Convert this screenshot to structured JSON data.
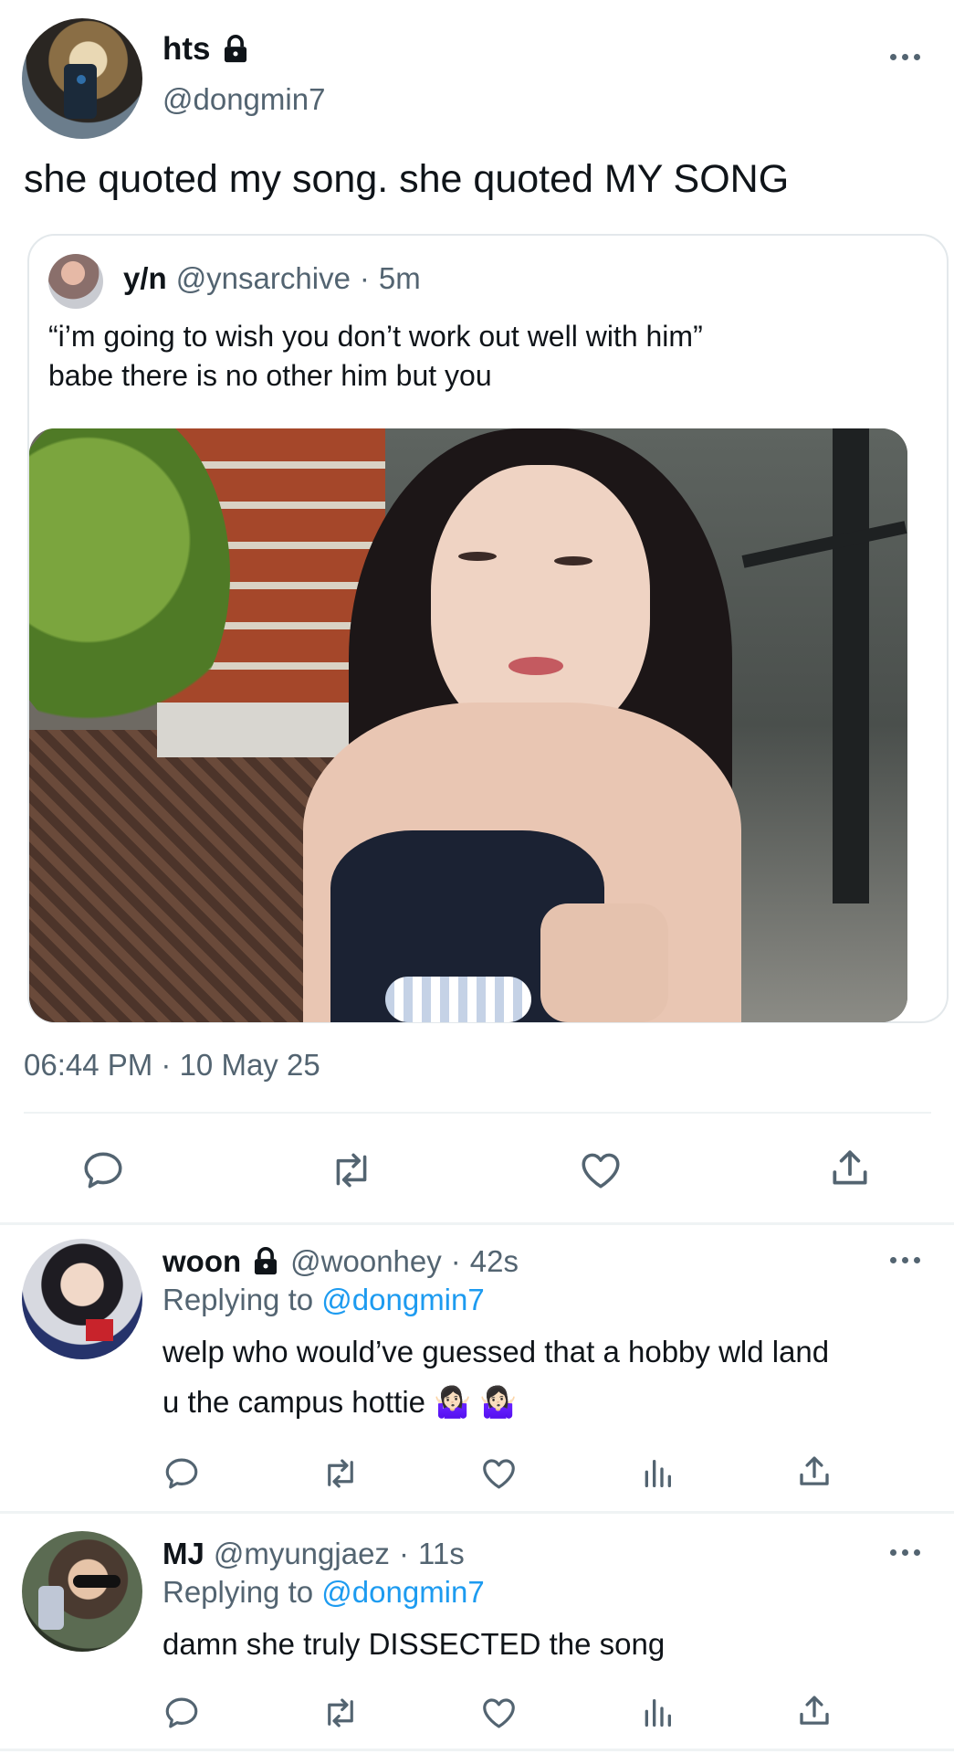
{
  "main_tweet": {
    "display_name": "hts",
    "handle": "@dongmin7",
    "text": "she quoted my song. she quoted MY SONG",
    "timestamp": "06:44 PM · 10 May 25",
    "locked": true
  },
  "quoted_tweet": {
    "display_name": "y/n",
    "handle": "@ynsarchive",
    "sep": "·",
    "time": "5m",
    "line1": "“i’m going to wish you don’t work out well with him”",
    "line2": "babe there is no other him but you"
  },
  "replies": [
    {
      "display_name": "woon",
      "handle": "@woonhey",
      "time": "42s",
      "replying_label": "Replying to",
      "replying_to": "@dongmin7",
      "line1": "welp who would’ve guessed that a hobby wld land",
      "line2": "u the campus hottie 🤷🏻‍♀️ 🤷🏻‍♀️",
      "locked": true
    },
    {
      "display_name": "MJ",
      "handle": "@myungjaez",
      "time": "11s",
      "replying_label": "Replying to",
      "replying_to": "@dongmin7",
      "line1": "damn she truly DISSECTED the song",
      "locked": false
    }
  ],
  "icons": {
    "reply": "reply-icon",
    "retweet": "retweet-icon",
    "like": "heart-icon",
    "views": "views-icon",
    "share": "share-icon",
    "lock": "lock-icon",
    "more": "more-icon"
  },
  "colors": {
    "text": "#0f1419",
    "muted": "#536471",
    "link": "#1d9bf0",
    "divider": "#eff3f4"
  }
}
